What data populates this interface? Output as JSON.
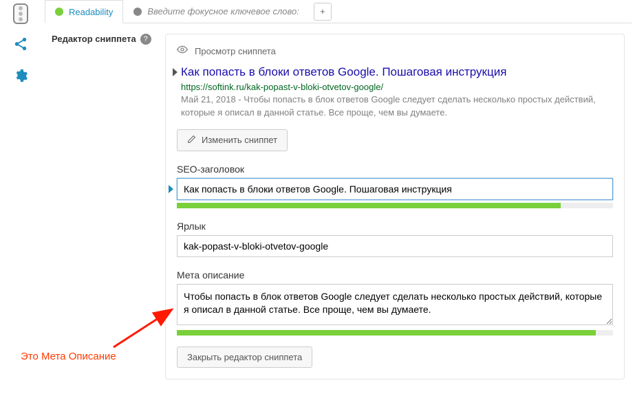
{
  "tabs": {
    "readability": "Readability",
    "keyword_placeholder": "Введите фокусное ключевое слово:"
  },
  "editor": {
    "section_label": "Редактор сниппета",
    "preview_label": "Просмотр сниппета",
    "edit_button": "Изменить сниппет",
    "close_button": "Закрыть редактор сниппета"
  },
  "snippet": {
    "title": "Как попасть в блоки ответов Google. Пошаговая инструкция",
    "url": "https://softink.ru/kak-popast-v-bloki-otvetov-google/",
    "date": "Май 21, 2018",
    "description": "Чтобы попасть в блок ответов Google следует сделать несколько простых действий, которые я описал в данной статье. Все проще, чем вы думаете."
  },
  "fields": {
    "seo_title_label": "SEO-заголовок",
    "seo_title_value": "Как попасть в блоки ответов Google. Пошаговая инструкция",
    "slug_label": "Ярлык",
    "slug_value": "kak-popast-v-bloki-otvetov-google",
    "meta_desc_label": "Мета описание",
    "meta_desc_value": "Чтобы попасть в блок ответов Google следует сделать несколько простых действий, которые я описал в данной статье. Все проще, чем вы думаете."
  },
  "progress": {
    "seo_title_pct": "88%",
    "meta_desc_pct": "96%"
  },
  "annotation": "Это Мета Описание"
}
